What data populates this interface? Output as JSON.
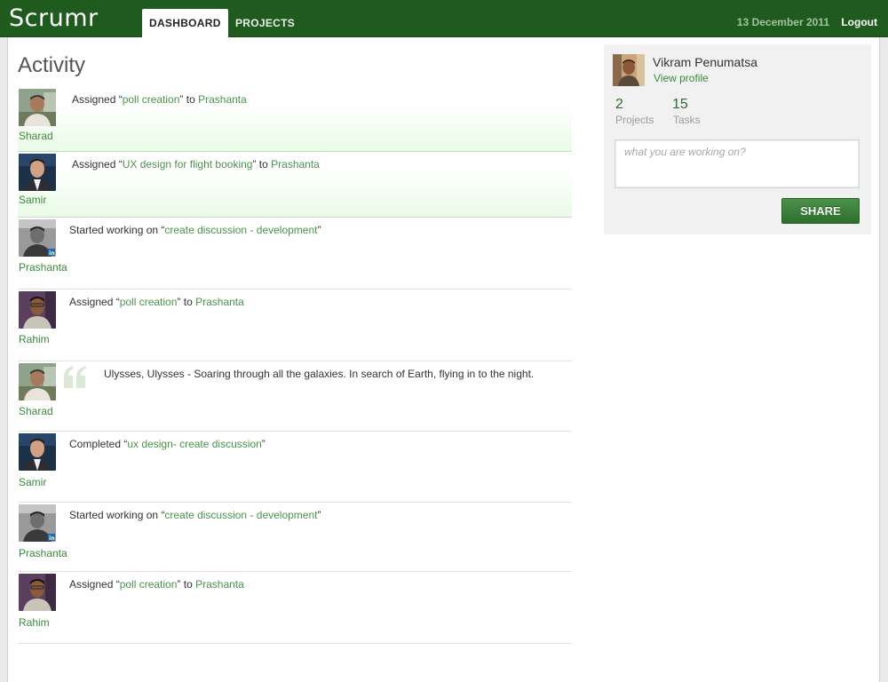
{
  "header": {
    "logo": "Scrumr",
    "tabs": [
      {
        "label": "DASHBOARD",
        "active": true
      },
      {
        "label": "PROJECTS",
        "active": false
      }
    ],
    "date": "13 December 2011",
    "logout": "Logout"
  },
  "colors": {
    "brand": "#1f5a1f",
    "link": "#4a944a",
    "highlight": "#e9fbe6"
  },
  "activity": {
    "title": "Activity",
    "items": [
      {
        "user": "Sharad",
        "avatar": "sharad",
        "highlight": true,
        "parts": [
          "Assigned “",
          "poll creation",
          "” to ",
          "Prashanta",
          ""
        ]
      },
      {
        "user": "Samir",
        "avatar": "samir",
        "highlight": true,
        "parts": [
          "Assigned “",
          "UX design for flight booking",
          "” to ",
          "Prashanta",
          ""
        ]
      },
      {
        "user": "Prashanta",
        "avatar": "prashanta",
        "highlight": false,
        "parts": [
          "Started working on “",
          "create discussion - development",
          "”",
          "",
          ""
        ]
      },
      {
        "user": "Rahim",
        "avatar": "rahim",
        "highlight": false,
        "parts": [
          "Assigned “",
          "poll creation",
          "” to ",
          "Prashanta",
          ""
        ]
      },
      {
        "user": "Sharad",
        "avatar": "sharad",
        "highlight": false,
        "quote": true,
        "text": "Ulysses, Ulysses - Soaring through all the galaxies. In search of Earth, flying in to the night."
      },
      {
        "user": "Samir",
        "avatar": "samir",
        "highlight": false,
        "parts": [
          "Completed “",
          "ux design- create discussion",
          "”",
          "",
          ""
        ]
      },
      {
        "user": "Prashanta",
        "avatar": "prashanta",
        "highlight": false,
        "parts": [
          "Started working on “",
          "create discussion - development",
          "”",
          "",
          ""
        ]
      },
      {
        "user": "Rahim",
        "avatar": "rahim",
        "highlight": false,
        "parts": [
          "Assigned “",
          "poll creation",
          "” to ",
          "Prashanta",
          ""
        ]
      }
    ]
  },
  "profile": {
    "name": "Vikram Penumatsa",
    "view_profile": "View profile",
    "projects_count": "2",
    "projects_label": "Projects",
    "tasks_count": "15",
    "tasks_label": "Tasks",
    "status_placeholder": "what you are working on?",
    "share_label": "SHARE"
  }
}
